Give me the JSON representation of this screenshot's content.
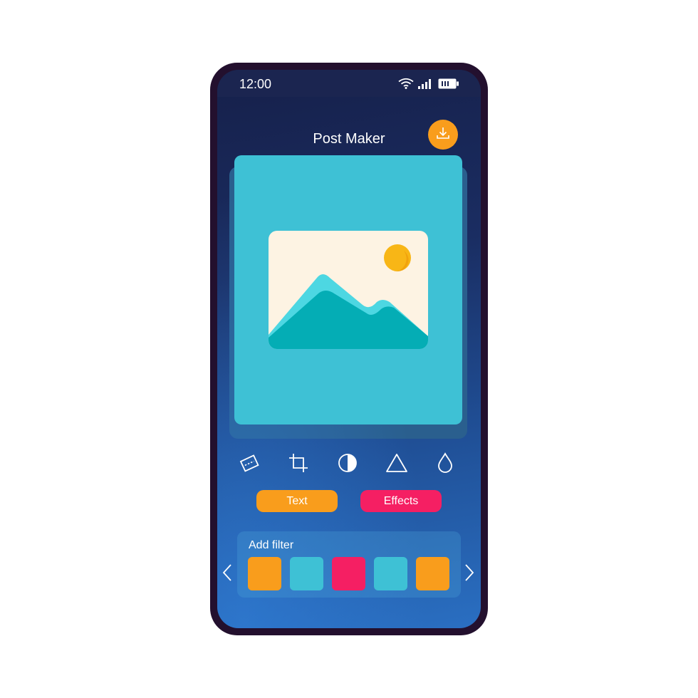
{
  "status_bar": {
    "time": "12:00",
    "icons": [
      "wifi-icon",
      "signal-icon",
      "battery-icon"
    ]
  },
  "header": {
    "title": "Post Maker",
    "download_icon": "download-icon"
  },
  "canvas": {
    "placeholder_icon": "image-placeholder-icon"
  },
  "tools": [
    {
      "name": "rotate",
      "icon": "rotate-icon"
    },
    {
      "name": "crop",
      "icon": "crop-icon"
    },
    {
      "name": "contrast",
      "icon": "contrast-icon"
    },
    {
      "name": "shape",
      "icon": "triangle-icon"
    },
    {
      "name": "color",
      "icon": "droplet-icon"
    }
  ],
  "actions": {
    "text_label": "Text",
    "effects_label": "Effects"
  },
  "filters": {
    "label": "Add filter",
    "swatches": [
      "#f99d1c",
      "#3ec1d5",
      "#f51f63",
      "#3ec1d5",
      "#f99d1c"
    ]
  },
  "colors": {
    "accent_orange": "#f99d1c",
    "accent_pink": "#f51f63",
    "accent_cyan": "#3ec1d5",
    "frame": "#23102e"
  }
}
